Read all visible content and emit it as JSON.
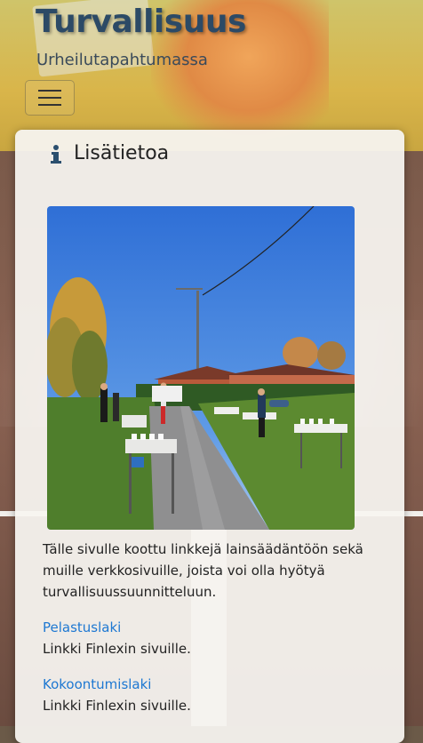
{
  "header": {
    "title": "Turvallisuus",
    "subtitle": "Urheilutapahtumassa"
  },
  "nav": {
    "toggle_icon": "hamburger-menu-icon"
  },
  "card": {
    "icon": "info-icon",
    "title": "Lisätietoa",
    "photo_icon": "race-refreshment-station-photo",
    "intro": "Tälle sivulle koottu linkkejä lainsäädäntöön sekä muille verkkosivuille, joista voi olla hyötyä turvallisuussuunnitteluun.",
    "links": [
      {
        "label": "Pelastuslaki",
        "description": "Linkki Finlexin sivuille."
      },
      {
        "label": "Kokoontumislaki",
        "description": "Linkki Finlexin sivuille."
      }
    ]
  },
  "colors": {
    "title": "#2c4a66",
    "link": "#1e78d2",
    "icon": "#2b4f6e"
  }
}
